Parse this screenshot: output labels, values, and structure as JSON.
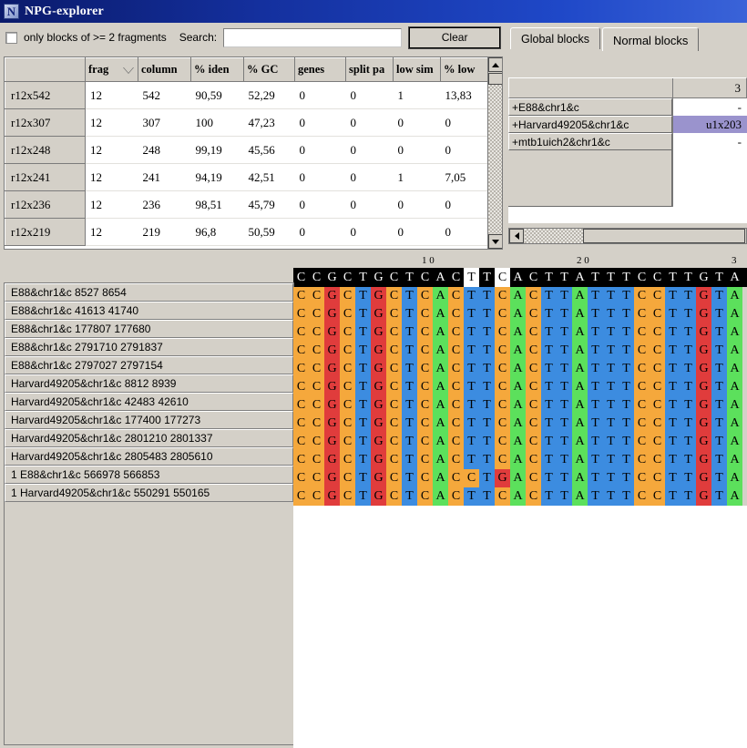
{
  "window": {
    "title": "NPG-explorer",
    "icon": "N",
    "icon_name": "app-icon"
  },
  "toolbar": {
    "checkbox_label": "only blocks of >= 2 fragments",
    "checkbox_checked": false,
    "search_label": "Search:",
    "search_value": "",
    "search_placeholder": "",
    "clear_label": "Clear"
  },
  "blocks_table": {
    "columns": [
      "",
      "frag",
      "column",
      "% iden",
      "% GC",
      "genes",
      "split pa",
      "low sim",
      "% low"
    ],
    "sorted_column_index": 1,
    "rows": [
      {
        "name": "r12x542",
        "frag": "12",
        "columns": "542",
        "pct_ident": "90,59",
        "pct_gc": "52,29",
        "genes": "0",
        "split_parts": "0",
        "low_similarity": "1",
        "pct_low": "13,83"
      },
      {
        "name": "r12x307",
        "frag": "12",
        "columns": "307",
        "pct_ident": "100",
        "pct_gc": "47,23",
        "genes": "0",
        "split_parts": "0",
        "low_similarity": "0",
        "pct_low": "0"
      },
      {
        "name": "r12x248",
        "frag": "12",
        "columns": "248",
        "pct_ident": "99,19",
        "pct_gc": "45,56",
        "genes": "0",
        "split_parts": "0",
        "low_similarity": "0",
        "pct_low": "0"
      },
      {
        "name": "r12x241",
        "frag": "12",
        "columns": "241",
        "pct_ident": "94,19",
        "pct_gc": "42,51",
        "genes": "0",
        "split_parts": "0",
        "low_similarity": "1",
        "pct_low": "7,05"
      },
      {
        "name": "r12x236",
        "frag": "12",
        "columns": "236",
        "pct_ident": "98,51",
        "pct_gc": "45,79",
        "genes": "0",
        "split_parts": "0",
        "low_similarity": "0",
        "pct_low": "0"
      },
      {
        "name": "r12x219",
        "frag": "12",
        "columns": "219",
        "pct_ident": "96,8",
        "pct_gc": "50,59",
        "genes": "0",
        "split_parts": "0",
        "low_similarity": "0",
        "pct_low": "0"
      }
    ]
  },
  "tabs": [
    {
      "label": "Global blocks",
      "active": false
    },
    {
      "label": "Normal blocks",
      "active": true
    }
  ],
  "genomes_table": {
    "header_value": "3",
    "rows": [
      {
        "name": "+E88&chr1&c",
        "value": "-",
        "selected": false
      },
      {
        "name": "+Harvard49205&chr1&c",
        "value": "u1x203",
        "selected": true
      },
      {
        "name": "+mtb1uich2&chr1&c",
        "value": "-",
        "selected": false
      }
    ],
    "selection_color": "#9a93cd"
  },
  "alignment": {
    "ruler_labels": [
      "1 0",
      "2 0",
      "3"
    ],
    "ruler_positions": [
      9,
      19,
      29
    ],
    "consensus": "CCGCTGCTCACTTCACTTATTTCCTTGTA",
    "consensus_inverted_positions": [
      11,
      13
    ],
    "base_colors": {
      "A": "#5ce05c",
      "C": "#f5a83c",
      "G": "#e03c3c",
      "T": "#3c8ce0"
    },
    "rows": [
      {
        "label": "E88&chr1&c  8527  8654",
        "seq": "CCGCTGCTCACTTCACTTATTTCCTTGTA"
      },
      {
        "label": "E88&chr1&c  41613  41740",
        "seq": "CCGCTGCTCACTTCACTTATTTCCTTGTA"
      },
      {
        "label": "E88&chr1&c  177807  177680",
        "seq": "CCGCTGCTCACTTCACTTATTTCCTTGTA"
      },
      {
        "label": "E88&chr1&c  2791710  2791837",
        "seq": "CCGCTGCTCACTTCACTTATTTCCTTGTA"
      },
      {
        "label": "E88&chr1&c  2797027  2797154",
        "seq": "CCGCTGCTCACTTCACTTATTTCCTTGTA"
      },
      {
        "label": "Harvard49205&chr1&c  8812  8939",
        "seq": "CCGCTGCTCACTTCACTTATTTCCTTGTA"
      },
      {
        "label": "Harvard49205&chr1&c  42483  42610",
        "seq": "CCGCTGCTCACTTCACTTATTTCCTTGTA"
      },
      {
        "label": "Harvard49205&chr1&c  177400  177273",
        "seq": "CCGCTGCTCACTTCACTTATTTCCTTGTA"
      },
      {
        "label": "Harvard49205&chr1&c  2801210  2801337",
        "seq": "CCGCTGCTCACTTCACTTATTTCCTTGTA"
      },
      {
        "label": "Harvard49205&chr1&c  2805483  2805610",
        "seq": "CCGCTGCTCACTTCACTTATTTCCTTGTA"
      },
      {
        "label": "1 E88&chr1&c  566978  566853",
        "seq": "CCGCTGCTCACCTGACTTATTTCCTTGTA"
      },
      {
        "label": "1 Harvard49205&chr1&c  550291  550165",
        "seq": "CCGCTGCTCACTTCACTTATTTCCTTGTA"
      }
    ]
  },
  "scrollbars": {
    "table_vertical": {
      "up": "▲",
      "down": "▼"
    },
    "right_horizontal": {
      "left": "◀"
    }
  }
}
